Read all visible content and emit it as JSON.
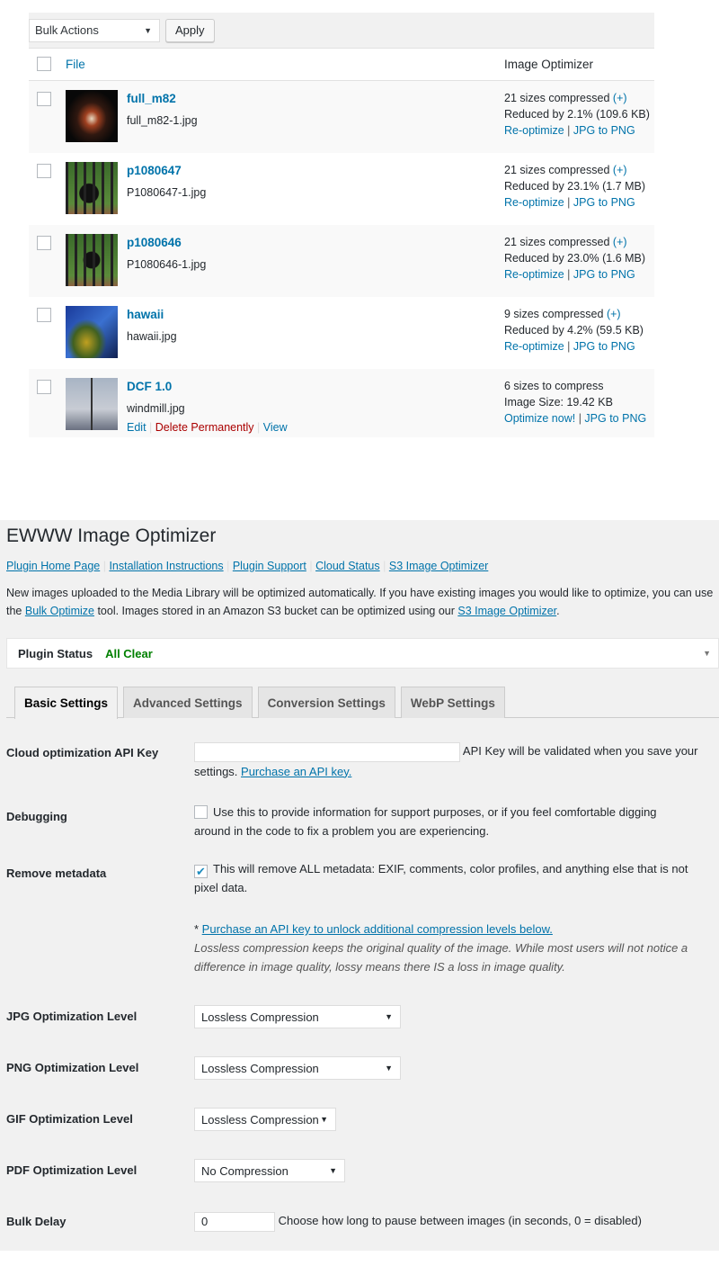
{
  "media": {
    "bulk_select": "Bulk Actions",
    "apply": "Apply",
    "col_file": "File",
    "col_optimizer": "Image Optimizer",
    "rows": [
      {
        "title": "full_m82",
        "file": "full_m82-1.jpg",
        "line1": "21 sizes compressed",
        "plus": "(+)",
        "line2": "Reduced by 2.1% (109.6 KB)",
        "action1": "Re-optimize",
        "action2": "JPG to PNG"
      },
      {
        "title": "p1080647",
        "file": "P1080647-1.jpg",
        "line1": "21 sizes compressed",
        "plus": "(+)",
        "line2": "Reduced by 23.1% (1.7 MB)",
        "action1": "Re-optimize",
        "action2": "JPG to PNG"
      },
      {
        "title": "p1080646",
        "file": "P1080646-1.jpg",
        "line1": "21 sizes compressed",
        "plus": "(+)",
        "line2": "Reduced by 23.0% (1.6 MB)",
        "action1": "Re-optimize",
        "action2": "JPG to PNG"
      },
      {
        "title": "hawaii",
        "file": "hawaii.jpg",
        "line1": "9 sizes compressed",
        "plus": "(+)",
        "line2": "Reduced by 4.2% (59.5 KB)",
        "action1": "Re-optimize",
        "action2": "JPG to PNG"
      },
      {
        "title": "DCF 1.0",
        "file": "windmill.jpg",
        "line1": "6 sizes to compress",
        "line2": "Image Size: 19.42 KB",
        "action1": "Optimize now!",
        "action2": "JPG to PNG",
        "edit": "Edit",
        "delete": "Delete Permanently",
        "view": "View"
      }
    ]
  },
  "settings": {
    "title": "EWWW Image Optimizer",
    "links": [
      "Plugin Home Page",
      "Installation Instructions",
      "Plugin Support",
      "Cloud Status",
      "S3 Image Optimizer"
    ],
    "intro1": "New images uploaded to the Media Library will be optimized automatically. If you have existing images you would like to optimize, you can use",
    "intro2a": "the ",
    "intro_link1": "Bulk Optimize",
    "intro2b": " tool. Images stored in an Amazon S3 bucket can be optimized using our ",
    "intro_link2": "S3 Image Optimizer",
    "intro2c": ".",
    "status_label": "Plugin Status",
    "status_value": "All Clear",
    "tabs": [
      "Basic Settings",
      "Advanced Settings",
      "Conversion Settings",
      "WebP Settings"
    ],
    "api_label": "Cloud optimization API Key",
    "api_value": "",
    "api_help": "API Key will be validated when you save your",
    "api_help2": "settings. ",
    "api_link": "Purchase an API key.",
    "debug_label": "Debugging",
    "debug_text": "Use this to provide information for support purposes, or if you feel comfortable digging",
    "debug_text2": "around in the code to fix a problem you are experiencing.",
    "meta_label": "Remove metadata",
    "meta_text": "This will remove ALL metadata: EXIF, comments, color profiles, and anything else that is not",
    "meta_text2": "pixel data.",
    "note_star": "* ",
    "note_link": "Purchase an API key to unlock additional compression levels below.",
    "note_italic": "Lossless compression keeps the original quality of the image. While most users will not notice a",
    "note_italic2": "difference in image quality, lossy means there IS a loss in image quality.",
    "jpg_label": "JPG Optimization Level",
    "jpg_value": "Lossless Compression",
    "png_label": "PNG Optimization Level",
    "png_value": "Lossless Compression",
    "gif_label": "GIF Optimization Level",
    "gif_value": "Lossless Compression",
    "pdf_label": "PDF Optimization Level",
    "pdf_value": "No Compression",
    "delay_label": "Bulk Delay",
    "delay_value": "0",
    "delay_help": "Choose how long to pause between images (in seconds, 0 = disabled)"
  }
}
